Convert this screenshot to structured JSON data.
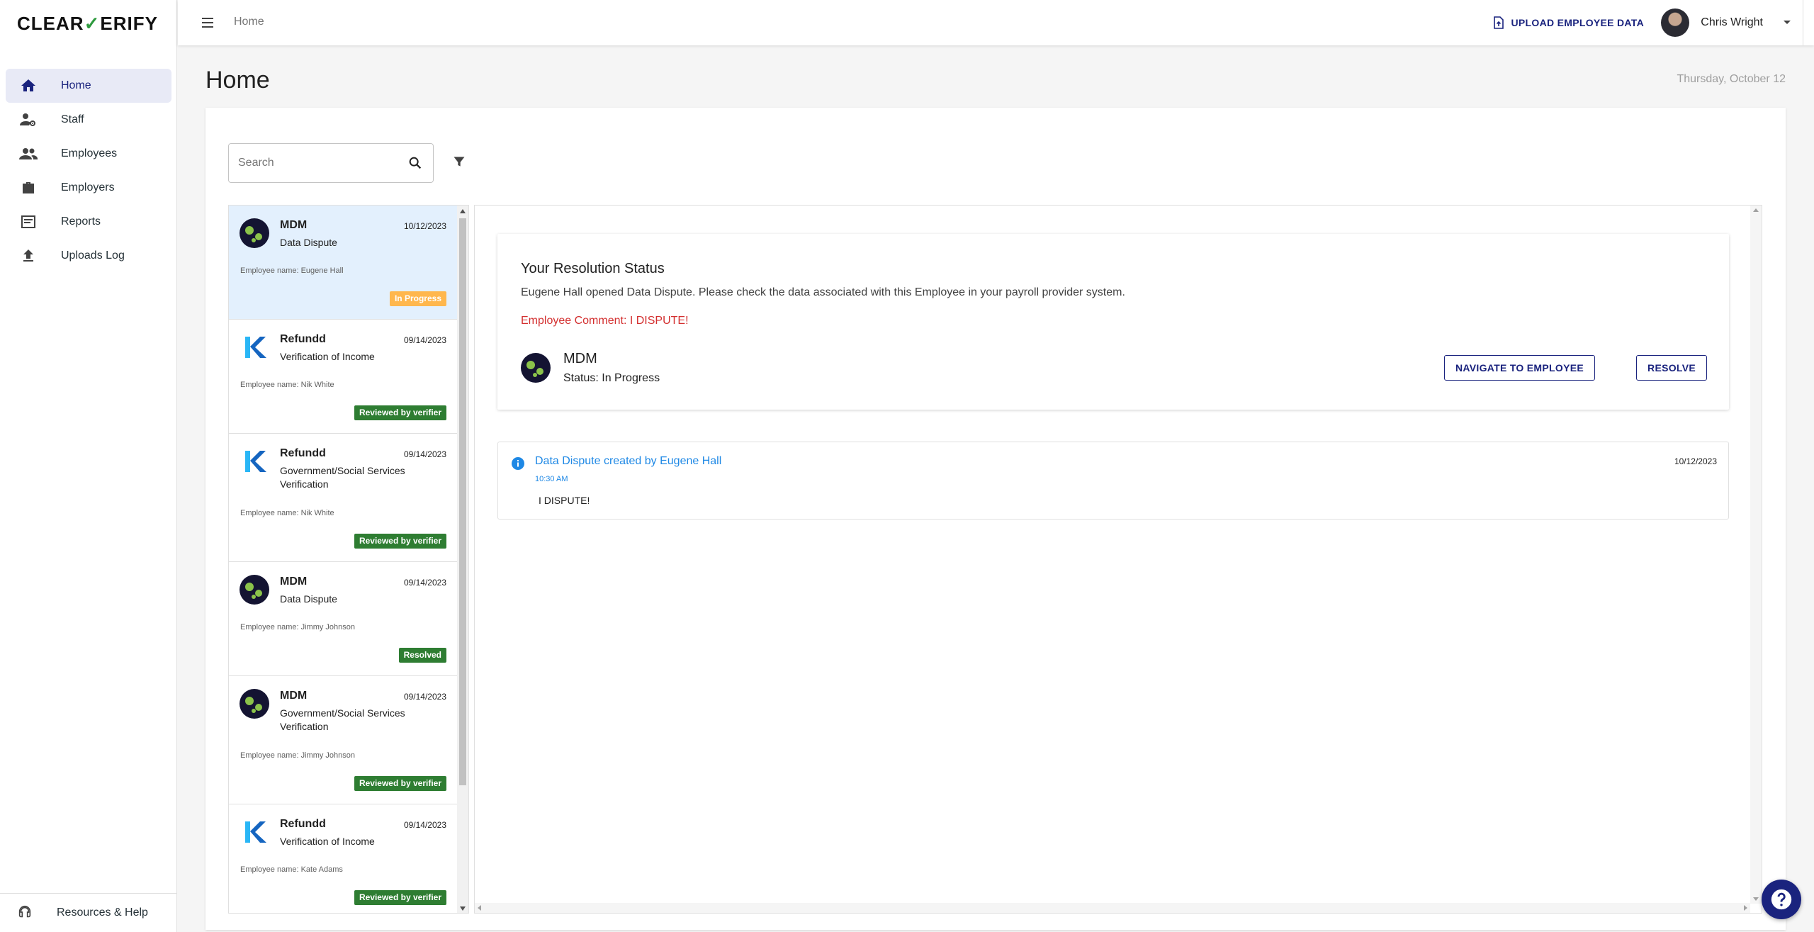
{
  "app": {
    "logo_left": "CLEAR",
    "logo_check": "✓",
    "logo_right": "ERIFY"
  },
  "sidebar": {
    "items": [
      {
        "label": "Home",
        "icon": "home-icon"
      },
      {
        "label": "Staff",
        "icon": "staff-icon"
      },
      {
        "label": "Employees",
        "icon": "employees-icon"
      },
      {
        "label": "Employers",
        "icon": "briefcase-icon"
      },
      {
        "label": "Reports",
        "icon": "reports-icon"
      },
      {
        "label": "Uploads Log",
        "icon": "upload-icon"
      }
    ],
    "bottom_label": "Resources & Help"
  },
  "topbar": {
    "breadcrumb": "Home",
    "upload_label": "UPLOAD EMPLOYEE DATA",
    "user_name": "Chris Wright"
  },
  "page": {
    "title": "Home",
    "date": "Thursday, October 12"
  },
  "search": {
    "placeholder": "Search"
  },
  "list": {
    "items": [
      {
        "name": "MDM",
        "type": "Data Dispute",
        "date": "10/12/2023",
        "employee": "Employee name: Eugene Hall",
        "status": "In Progress",
        "logo": "mdm"
      },
      {
        "name": "Refundd",
        "type": "Verification of Income",
        "date": "09/14/2023",
        "employee": "Employee name: Nik White",
        "status": "Reviewed by verifier",
        "logo": "refundd"
      },
      {
        "name": "Refundd",
        "type": "Government/Social Services Verification",
        "date": "09/14/2023",
        "employee": "Employee name: Nik White",
        "status": "Reviewed by verifier",
        "logo": "refundd"
      },
      {
        "name": "MDM",
        "type": "Data Dispute",
        "date": "09/14/2023",
        "employee": "Employee name: Jimmy Johnson",
        "status": "Resolved",
        "logo": "mdm"
      },
      {
        "name": "MDM",
        "type": "Government/Social Services Verification",
        "date": "09/14/2023",
        "employee": "Employee name: Jimmy Johnson",
        "status": "Reviewed by verifier",
        "logo": "mdm"
      },
      {
        "name": "Refundd",
        "type": "Verification of Income",
        "date": "09/14/2023",
        "employee": "Employee name: Kate Adams",
        "status": "Reviewed by verifier",
        "logo": "refundd"
      }
    ]
  },
  "detail": {
    "title": "Your Resolution Status",
    "description": "Eugene Hall opened Data Dispute. Please check the data associated with this Employee in your payroll provider system.",
    "comment": "Employee Comment: I DISPUTE!",
    "org_name": "MDM",
    "org_status": "Status: In Progress",
    "navigate_label": "NAVIGATE TO EMPLOYEE",
    "resolve_label": "RESOLVE",
    "activity": {
      "title": "Data Dispute created by Eugene Hall",
      "time": "10:30 AM",
      "date": "10/12/2023",
      "body": "I DISPUTE!"
    }
  },
  "colors": {
    "brand": "#1a237e",
    "in_progress": "#ffb74d",
    "reviewed": "#2e7d32",
    "comment": "#d32f2f",
    "link": "#1e88e5"
  }
}
